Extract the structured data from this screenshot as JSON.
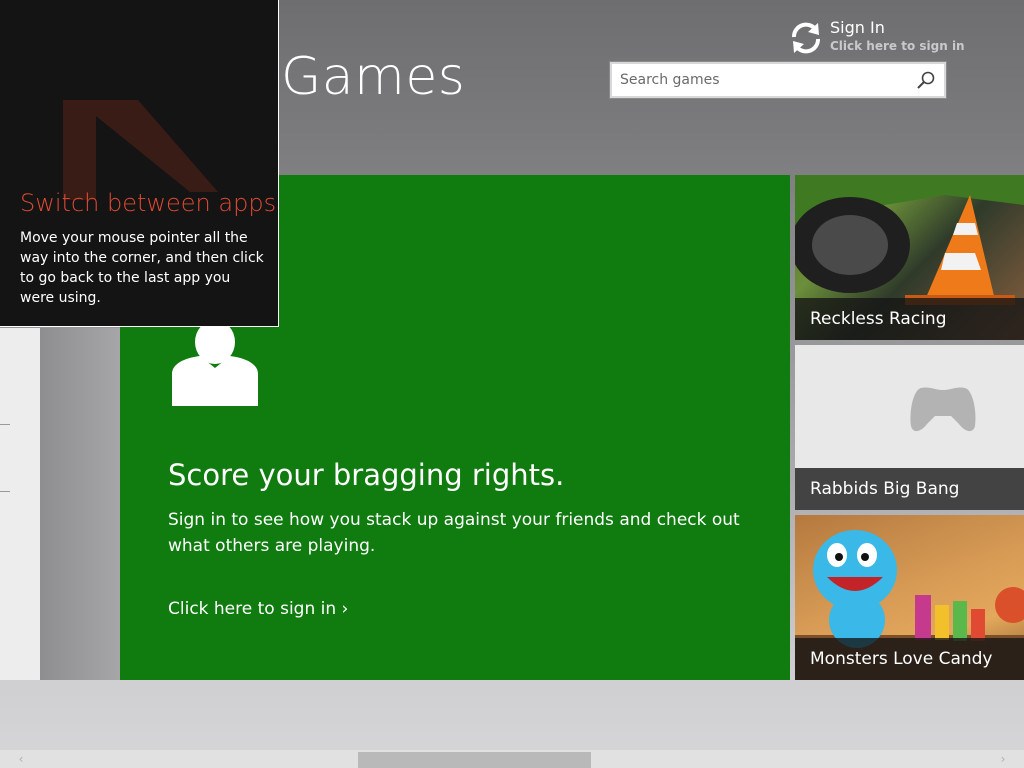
{
  "header": {
    "title": "Games"
  },
  "sign_in": {
    "title": "Sign In",
    "subtitle": "Click here to sign in",
    "icon": "sync-icon"
  },
  "search": {
    "placeholder": "Search games",
    "icon": "search-icon"
  },
  "hero": {
    "color": "#107c10",
    "icon": "person-icon",
    "headline": "Score your bragging rights.",
    "description": "Sign in to see how you stack up against your friends and check out what others are playing.",
    "cta": "Click here to sign in ›"
  },
  "tiles": [
    {
      "label": "Reckless Racing"
    },
    {
      "label": "Rabbids Big Bang",
      "icon": "gamepad-icon"
    },
    {
      "label": "Monsters Love Candy"
    }
  ],
  "charm_tip": {
    "title": "Switch between apps",
    "body": "Move your mouse pointer all the way into the corner, and then click to go back to the last app you were using.",
    "accent": "#e04a32"
  }
}
